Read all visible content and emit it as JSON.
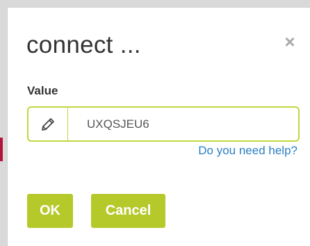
{
  "dialog": {
    "title": "connect ...",
    "close_label": "×"
  },
  "field": {
    "label": "Value",
    "value": "UXQSJEU6",
    "icon": "pencil-icon"
  },
  "help": {
    "link_text": "Do you need help?"
  },
  "buttons": {
    "ok_label": "OK",
    "cancel_label": "Cancel"
  },
  "colors": {
    "accent": "#b5c92a",
    "input_border": "#c1d63f",
    "link": "#2a7fc4"
  }
}
